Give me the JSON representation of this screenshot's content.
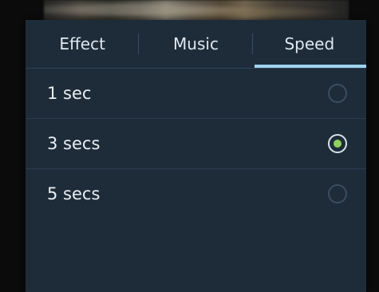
{
  "tabs": [
    {
      "label": "Effect",
      "active": false
    },
    {
      "label": "Music",
      "active": false
    },
    {
      "label": "Speed",
      "active": true
    }
  ],
  "speed_options": [
    {
      "label": "1 sec",
      "selected": false
    },
    {
      "label": "3 secs",
      "selected": true
    },
    {
      "label": "5 secs",
      "selected": false
    }
  ],
  "colors": {
    "panel_bg": "#1e2c3a",
    "active_tab_indicator": "#9ed4f0",
    "radio_selected_dot": "#8fd15a"
  }
}
